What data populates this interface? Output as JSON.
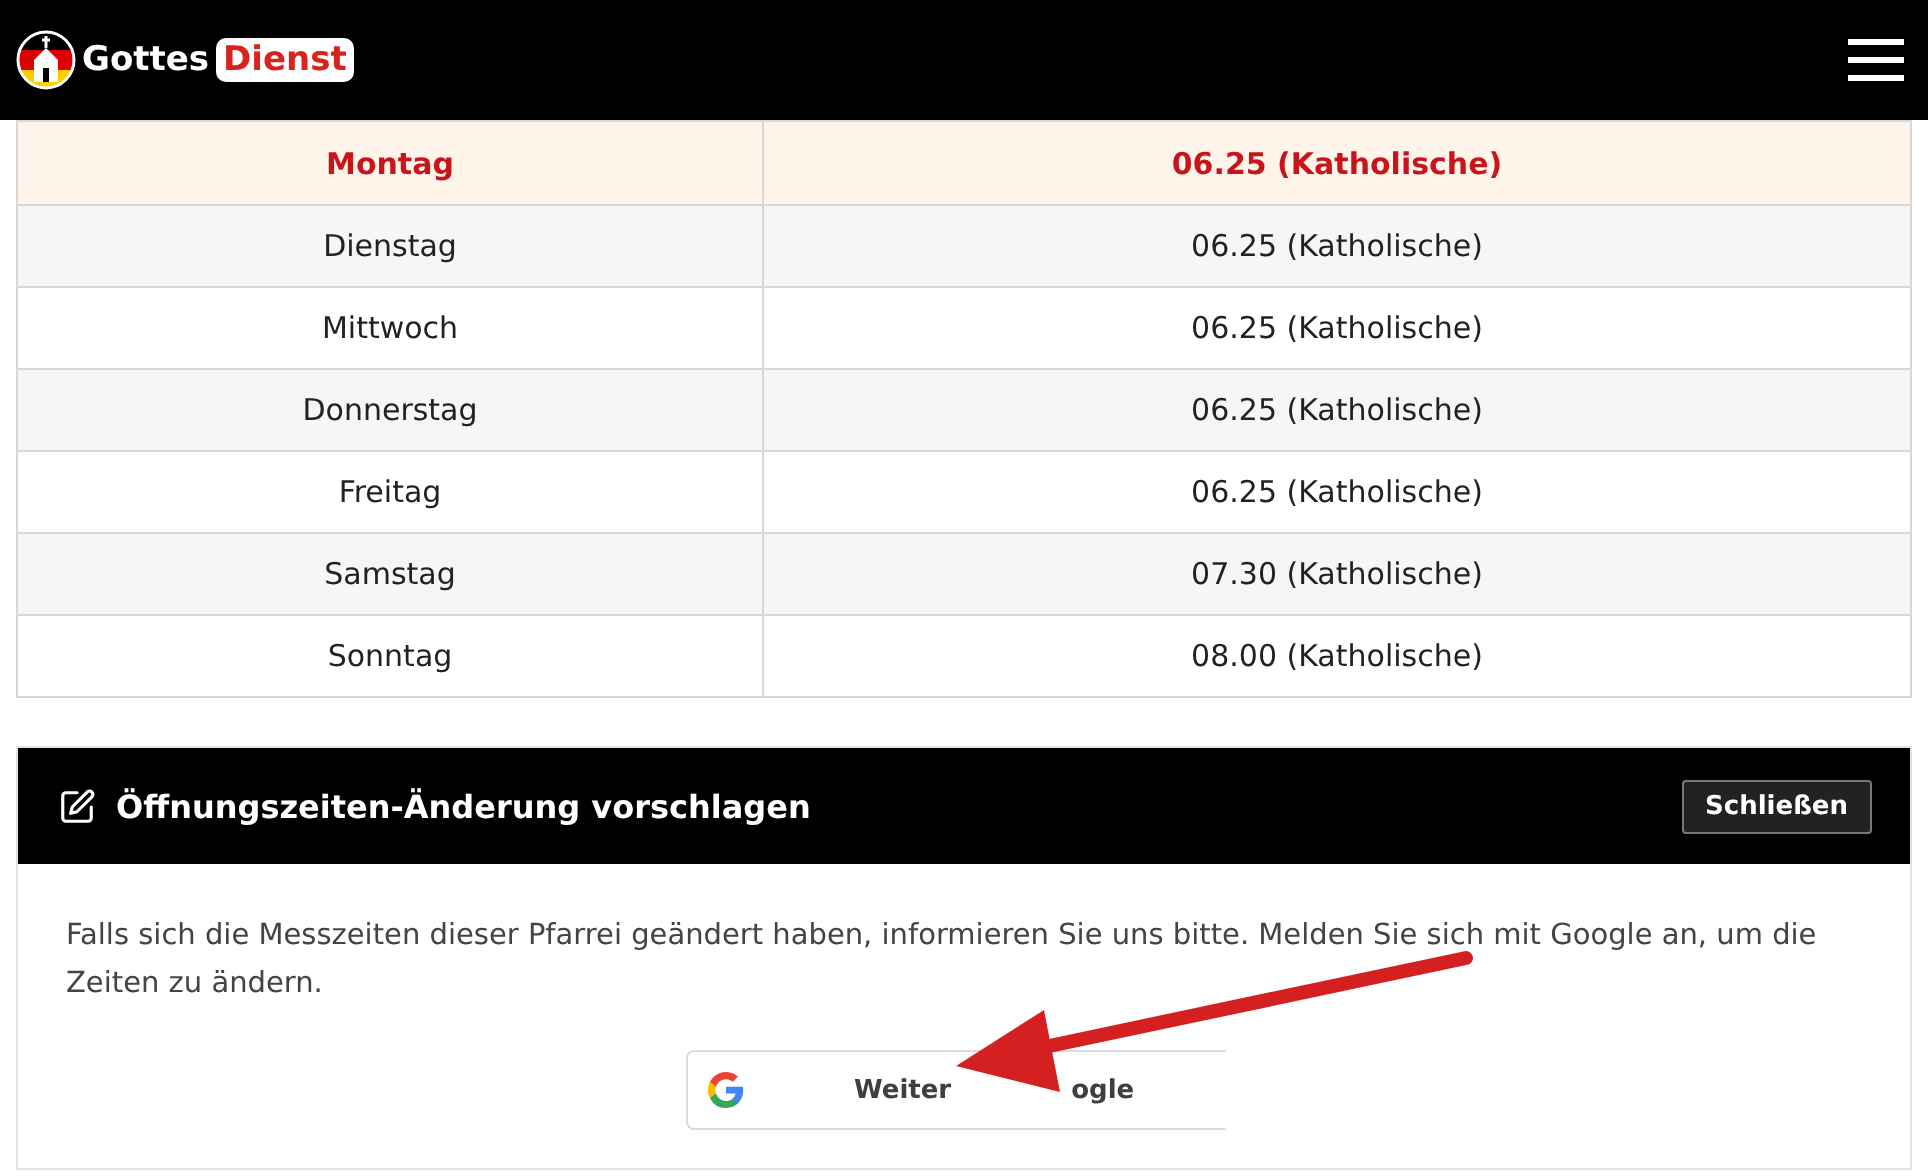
{
  "header": {
    "logo": {
      "word_1": "Gottes",
      "word_2": "Dienst"
    }
  },
  "schedule": {
    "rows": [
      {
        "day": "Montag",
        "time": "06.25 (Katholische)",
        "selected": true
      },
      {
        "day": "Dienstag",
        "time": "06.25 (Katholische)",
        "selected": false
      },
      {
        "day": "Mittwoch",
        "time": "06.25 (Katholische)",
        "selected": false
      },
      {
        "day": "Donnerstag",
        "time": "06.25 (Katholische)",
        "selected": false
      },
      {
        "day": "Freitag",
        "time": "06.25 (Katholische)",
        "selected": false
      },
      {
        "day": "Samstag",
        "time": "07.30 (Katholische)",
        "selected": false
      },
      {
        "day": "Sonntag",
        "time": "08.00 (Katholische)",
        "selected": false
      }
    ]
  },
  "suggest_panel": {
    "title": "Öffnungszeiten-Änderung vorschlagen",
    "close_button": "Schließen",
    "message": "Falls sich die Messzeiten dieser Pfarrei geändert haben, informieren Sie uns bitte. Melden Sie sich mit Google an, um die Zeiten zu ändern.",
    "google_button_visible_parts": [
      "Weiter",
      "ogle"
    ]
  }
}
